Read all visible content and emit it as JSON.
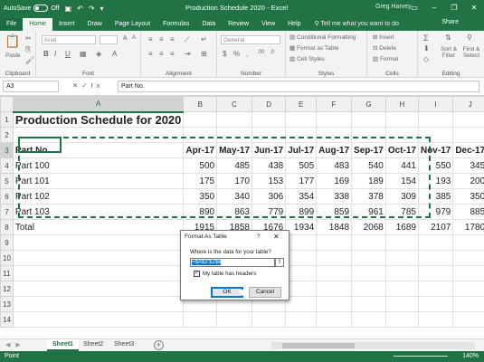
{
  "window": {
    "autosave_label": "AutoSave",
    "autosave_state": "Off",
    "title": "Production Schedule 2020  -  Excel",
    "user": "Greg Harvey",
    "share": "Share"
  },
  "ribbon_tabs": [
    "File",
    "Home",
    "Insert",
    "Draw",
    "Page Layout",
    "Formulas",
    "Data",
    "Review",
    "View",
    "Help"
  ],
  "active_tab": "Home",
  "tell_me": "Tell me what you want to do",
  "ribbon": {
    "clipboard": "Clipboard",
    "paste": "Paste",
    "font": "Font",
    "font_name": "Arial",
    "alignment": "Alignment",
    "number": "Number",
    "number_format": "General",
    "styles": "Styles",
    "conditional_formatting": "Conditional Formatting",
    "format_as_table": "Format as Table",
    "cell_styles": "Cell Styles",
    "cells": "Cells",
    "insert": "Insert",
    "delete": "Delete",
    "format": "Format",
    "editing": "Editing",
    "sort_filter": "Sort & Filter",
    "find_select": "Find & Select"
  },
  "formula_bar": {
    "name_box": "A3",
    "value": "Part No."
  },
  "columns": [
    "A",
    "B",
    "C",
    "D",
    "E",
    "F",
    "G",
    "H",
    "I",
    "J",
    "K"
  ],
  "sheet": {
    "title": "Production Schedule for 2020",
    "headers": [
      "Part No.",
      "Apr-17",
      "May-17",
      "Jun-17",
      "Jul-17",
      "Aug-17",
      "Sep-17",
      "Oct-17",
      "Nov-17",
      "Dec-17"
    ],
    "rows": [
      [
        "Part 100",
        "500",
        "485",
        "438",
        "505",
        "483",
        "540",
        "441",
        "550",
        "345"
      ],
      [
        "Part 101",
        "175",
        "170",
        "153",
        "177",
        "169",
        "189",
        "154",
        "193",
        "200"
      ],
      [
        "Part 102",
        "350",
        "340",
        "306",
        "354",
        "338",
        "378",
        "309",
        "385",
        "350"
      ],
      [
        "Part 103",
        "890",
        "863",
        "779",
        "899",
        "859",
        "961",
        "785",
        "979",
        "885"
      ],
      [
        "Total",
        "1915",
        "1858",
        "1676",
        "1934",
        "1848",
        "2068",
        "1689",
        "2107",
        "1780"
      ]
    ]
  },
  "sheet_tabs": [
    "Sheet1",
    "Sheet2",
    "Sheet3"
  ],
  "active_sheet": "Sheet1",
  "status": {
    "mode": "Point",
    "zoom": "140%"
  },
  "dialog": {
    "title": "Format As Table",
    "help": "?",
    "question": "Where is the data for your table?",
    "range": "=$A$3:$J$8",
    "headers_label": "My table has headers",
    "headers_checked": true,
    "ok": "OK",
    "cancel": "Cancel"
  }
}
